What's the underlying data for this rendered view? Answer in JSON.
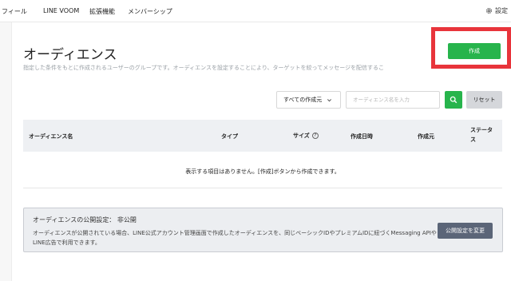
{
  "nav": {
    "items": [
      "フィール",
      "LINE VOOM",
      "拡張機能",
      "メンバーシップ"
    ],
    "settings_label": "設定"
  },
  "page": {
    "title": "オーディエンス",
    "description": "指定した条件をもとに作成されるユーザーのグループです。オーディエンスを設定することにより、ターゲットを絞ってメッセージを配信するこ",
    "create_button": "作成"
  },
  "filters": {
    "creator_select_value": "すべての作成元",
    "search_placeholder": "オーディエンス名を入力",
    "reset_label": "リセット"
  },
  "table": {
    "headers": {
      "name": "オーディエンス名",
      "type": "タイプ",
      "size": "サイズ",
      "created": "作成日時",
      "creator": "作成元",
      "status": "ステータス"
    },
    "empty_message": "表示する項目はありません。[作成]ボタンから作成できます。"
  },
  "privacy": {
    "title": "オーディエンスの公開設定： 非公開",
    "text": "オーディエンスが公開されている場合、LINE公式アカウント管理画面で作成したオーディエンスを、同じベーシックIDやプレミアムIDに紐づくMessaging APIやLINE広告で利用できます。",
    "button": "公開設定を変更"
  },
  "colors": {
    "primary_green": "#27b44c",
    "highlight_red": "#e8343b",
    "dark_button": "#5b6578"
  }
}
